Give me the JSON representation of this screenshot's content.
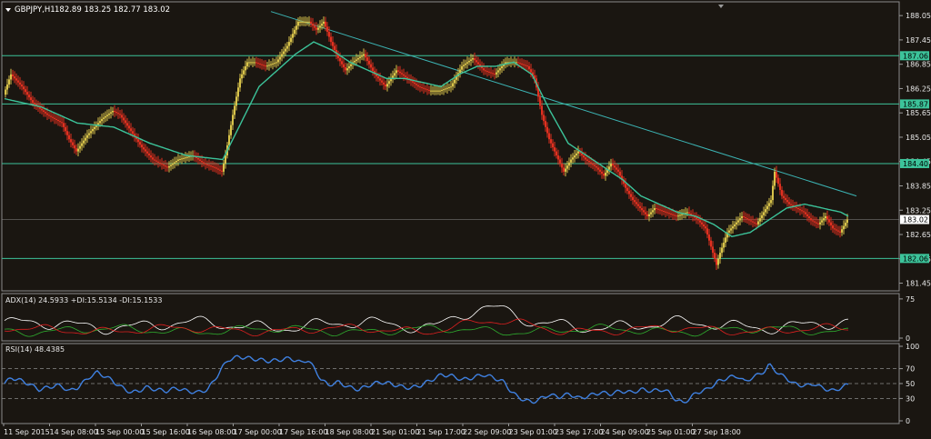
{
  "header": {
    "symbol_label": "GBPJPY,H1",
    "ohlc_label": "182.89 183.25 182.77 183.02"
  },
  "adx_panel": {
    "label": "ADX(14) 24.5933 +DI:15.5134 -DI:15.1533"
  },
  "rsi_panel": {
    "label": "RSI(14) 48.4385"
  },
  "colors": {
    "background": "#1a1611",
    "grid": "#3a3a3a",
    "bull_candle": "#d8c34a",
    "bear_candle": "#e03020",
    "moving_average": "#3cc39a",
    "trendline": "#3cb4b4",
    "level_line": "#3cc39a",
    "adx_line": "#ffffff",
    "plus_di_line": "#2fae2f",
    "minus_di_line": "#e02020",
    "rsi_line": "#3f80e0",
    "price_badge": "#ffffff",
    "level_badge": "#3cc39a"
  },
  "chart_data": [
    {
      "type": "candlestick",
      "symbol": "GBPJPY",
      "timeframe": "H1",
      "price_axis_ticks": [
        "188.05",
        "187.45",
        "186.85",
        "186.25",
        "185.65",
        "185.05",
        "184.45",
        "183.85",
        "183.25",
        "182.65",
        "182.05",
        "181.45"
      ],
      "ylim": [
        181.35,
        188.3
      ],
      "horizontal_levels": [
        {
          "label": "187.06",
          "value": 187.06
        },
        {
          "label": "185.87",
          "value": 185.87
        },
        {
          "label": "184.40",
          "value": 184.4
        },
        {
          "label": "182.06",
          "value": 182.06
        }
      ],
      "current_price": {
        "label": "183.02",
        "value": 183.02
      },
      "trendline": {
        "start": {
          "x": "17 Sep 00:00",
          "y": 188.15
        },
        "end": {
          "x": "27 Sep 18:00",
          "y": 183.6
        }
      },
      "time_axis_labels": [
        "11 Sep 2015",
        "14 Sep 08:00",
        "15 Sep 00:00",
        "15 Sep 16:00",
        "16 Sep 08:00",
        "17 Sep 00:00",
        "17 Sep 16:00",
        "18 Sep 08:00",
        "21 Sep 01:00",
        "21 Sep 17:00",
        "22 Sep 09:00",
        "23 Sep 01:00",
        "23 Sep 17:00",
        "24 Sep 09:00",
        "25 Sep 01:00",
        "27 Sep 18:00"
      ],
      "price_path": [
        [
          0,
          186.1
        ],
        [
          4,
          186.6
        ],
        [
          10,
          186.3
        ],
        [
          16,
          185.9
        ],
        [
          24,
          185.6
        ],
        [
          32,
          185.4
        ],
        [
          36,
          185.0
        ],
        [
          40,
          184.7
        ],
        [
          46,
          185.1
        ],
        [
          54,
          185.5
        ],
        [
          60,
          185.7
        ],
        [
          64,
          185.6
        ],
        [
          70,
          185.2
        ],
        [
          76,
          184.8
        ],
        [
          82,
          184.5
        ],
        [
          90,
          184.3
        ],
        [
          96,
          184.5
        ],
        [
          104,
          184.6
        ],
        [
          110,
          184.4
        ],
        [
          116,
          184.3
        ],
        [
          120,
          184.2
        ],
        [
          122,
          184.6
        ],
        [
          126,
          185.6
        ],
        [
          130,
          186.5
        ],
        [
          134,
          186.9
        ],
        [
          138,
          186.9
        ],
        [
          144,
          186.8
        ],
        [
          150,
          186.9
        ],
        [
          156,
          187.3
        ],
        [
          162,
          187.9
        ],
        [
          168,
          187.9
        ],
        [
          172,
          187.7
        ],
        [
          176,
          187.9
        ],
        [
          180,
          187.4
        ],
        [
          184,
          187.0
        ],
        [
          188,
          186.7
        ],
        [
          192,
          186.9
        ],
        [
          198,
          187.1
        ],
        [
          204,
          186.6
        ],
        [
          210,
          186.3
        ],
        [
          216,
          186.7
        ],
        [
          222,
          186.5
        ],
        [
          228,
          186.3
        ],
        [
          234,
          186.2
        ],
        [
          240,
          186.2
        ],
        [
          246,
          186.3
        ],
        [
          252,
          186.8
        ],
        [
          258,
          187.0
        ],
        [
          264,
          186.7
        ],
        [
          270,
          186.6
        ],
        [
          276,
          186.9
        ],
        [
          282,
          186.9
        ],
        [
          288,
          186.8
        ],
        [
          292,
          186.5
        ],
        [
          296,
          185.6
        ],
        [
          300,
          185.0
        ],
        [
          304,
          184.6
        ],
        [
          308,
          184.2
        ],
        [
          312,
          184.5
        ],
        [
          316,
          184.7
        ],
        [
          320,
          184.5
        ],
        [
          326,
          184.3
        ],
        [
          330,
          184.1
        ],
        [
          334,
          184.4
        ],
        [
          338,
          184.2
        ],
        [
          342,
          183.8
        ],
        [
          346,
          183.5
        ],
        [
          350,
          183.3
        ],
        [
          354,
          183.1
        ],
        [
          358,
          183.3
        ],
        [
          364,
          183.2
        ],
        [
          370,
          183.1
        ],
        [
          376,
          183.2
        ],
        [
          382,
          183.0
        ],
        [
          386,
          182.8
        ],
        [
          390,
          182.2
        ],
        [
          392,
          181.9
        ],
        [
          394,
          182.2
        ],
        [
          398,
          182.7
        ],
        [
          402,
          182.9
        ],
        [
          406,
          183.1
        ],
        [
          410,
          183.0
        ],
        [
          414,
          182.9
        ],
        [
          418,
          183.2
        ],
        [
          422,
          183.5
        ],
        [
          424,
          184.2
        ],
        [
          428,
          183.6
        ],
        [
          432,
          183.4
        ],
        [
          436,
          183.3
        ],
        [
          440,
          183.2
        ],
        [
          444,
          183.0
        ],
        [
          448,
          182.9
        ],
        [
          452,
          183.1
        ],
        [
          456,
          182.8
        ],
        [
          460,
          182.7
        ],
        [
          464,
          183.02
        ]
      ],
      "moving_average": [
        [
          0,
          186.0
        ],
        [
          20,
          185.8
        ],
        [
          40,
          185.4
        ],
        [
          60,
          185.3
        ],
        [
          80,
          184.9
        ],
        [
          100,
          184.6
        ],
        [
          120,
          184.5
        ],
        [
          130,
          185.4
        ],
        [
          140,
          186.3
        ],
        [
          150,
          186.7
        ],
        [
          160,
          187.1
        ],
        [
          170,
          187.4
        ],
        [
          180,
          187.2
        ],
        [
          190,
          186.9
        ],
        [
          200,
          186.7
        ],
        [
          210,
          186.5
        ],
        [
          220,
          186.5
        ],
        [
          230,
          186.4
        ],
        [
          240,
          186.3
        ],
        [
          250,
          186.6
        ],
        [
          260,
          186.8
        ],
        [
          270,
          186.8
        ],
        [
          280,
          186.9
        ],
        [
          290,
          186.6
        ],
        [
          300,
          185.7
        ],
        [
          310,
          184.9
        ],
        [
          320,
          184.6
        ],
        [
          330,
          184.3
        ],
        [
          340,
          184.0
        ],
        [
          350,
          183.6
        ],
        [
          360,
          183.4
        ],
        [
          370,
          183.2
        ],
        [
          380,
          183.1
        ],
        [
          390,
          182.9
        ],
        [
          400,
          182.6
        ],
        [
          410,
          182.7
        ],
        [
          420,
          183.0
        ],
        [
          430,
          183.3
        ],
        [
          440,
          183.4
        ],
        [
          450,
          183.3
        ],
        [
          460,
          183.2
        ],
        [
          464,
          183.1
        ]
      ]
    },
    {
      "type": "line",
      "indicator": "ADX(14)",
      "y_ticks": [
        "75",
        "0"
      ],
      "ylim": [
        0,
        80
      ],
      "series": [
        {
          "name": "ADX(14)",
          "last_value": 24.5933
        },
        {
          "name": "+DI",
          "last_value": 15.5134
        },
        {
          "name": "-DI",
          "last_value": 15.1533
        }
      ]
    },
    {
      "type": "line",
      "indicator": "RSI(14)",
      "y_ticks": [
        "100",
        "70",
        "50",
        "30",
        "0"
      ],
      "ylim": [
        0,
        100
      ],
      "levels": [
        70,
        50,
        30
      ],
      "last_value": 48.4385,
      "values": [
        [
          0,
          50
        ],
        [
          4,
          58
        ],
        [
          8,
          55
        ],
        [
          12,
          52
        ],
        [
          16,
          47
        ],
        [
          20,
          42
        ],
        [
          26,
          45
        ],
        [
          30,
          48
        ],
        [
          34,
          45
        ],
        [
          38,
          40
        ],
        [
          42,
          44
        ],
        [
          46,
          52
        ],
        [
          50,
          60
        ],
        [
          54,
          65
        ],
        [
          58,
          60
        ],
        [
          62,
          55
        ],
        [
          66,
          48
        ],
        [
          70,
          42
        ],
        [
          74,
          38
        ],
        [
          78,
          40
        ],
        [
          82,
          45
        ],
        [
          88,
          42
        ],
        [
          94,
          40
        ],
        [
          100,
          44
        ],
        [
          106,
          40
        ],
        [
          112,
          38
        ],
        [
          118,
          42
        ],
        [
          122,
          55
        ],
        [
          126,
          70
        ],
        [
          130,
          82
        ],
        [
          136,
          86
        ],
        [
          142,
          84
        ],
        [
          148,
          82
        ],
        [
          154,
          80
        ],
        [
          160,
          82
        ],
        [
          166,
          84
        ],
        [
          172,
          78
        ],
        [
          176,
          82
        ],
        [
          180,
          70
        ],
        [
          184,
          55
        ],
        [
          188,
          48
        ],
        [
          194,
          52
        ],
        [
          200,
          45
        ],
        [
          206,
          42
        ],
        [
          212,
          48
        ],
        [
          218,
          52
        ],
        [
          224,
          50
        ],
        [
          230,
          46
        ],
        [
          236,
          44
        ],
        [
          242,
          48
        ],
        [
          248,
          55
        ],
        [
          254,
          62
        ],
        [
          260,
          60
        ],
        [
          266,
          55
        ],
        [
          272,
          58
        ],
        [
          278,
          62
        ],
        [
          284,
          58
        ],
        [
          290,
          52
        ],
        [
          294,
          40
        ],
        [
          298,
          32
        ],
        [
          302,
          28
        ],
        [
          306,
          25
        ],
        [
          310,
          28
        ],
        [
          316,
          35
        ],
        [
          322,
          32
        ],
        [
          328,
          36
        ],
        [
          334,
          30
        ],
        [
          340,
          34
        ],
        [
          346,
          38
        ],
        [
          352,
          36
        ],
        [
          358,
          40
        ],
        [
          364,
          38
        ],
        [
          370,
          42
        ],
        [
          376,
          40
        ],
        [
          382,
          42
        ],
        [
          386,
          38
        ],
        [
          390,
          28
        ],
        [
          394,
          24
        ],
        [
          398,
          30
        ],
        [
          402,
          38
        ],
        [
          408,
          42
        ],
        [
          414,
          52
        ],
        [
          420,
          58
        ],
        [
          426,
          60
        ],
        [
          430,
          52
        ],
        [
          434,
          58
        ],
        [
          438,
          62
        ],
        [
          442,
          68
        ],
        [
          444,
          75
        ],
        [
          446,
          72
        ],
        [
          450,
          62
        ],
        [
          454,
          58
        ],
        [
          458,
          50
        ],
        [
          462,
          48
        ],
        [
          466,
          47
        ],
        [
          470,
          50
        ],
        [
          474,
          45
        ],
        [
          478,
          42
        ],
        [
          482,
          40
        ],
        [
          486,
          45
        ],
        [
          490,
          48.44
        ]
      ]
    }
  ]
}
